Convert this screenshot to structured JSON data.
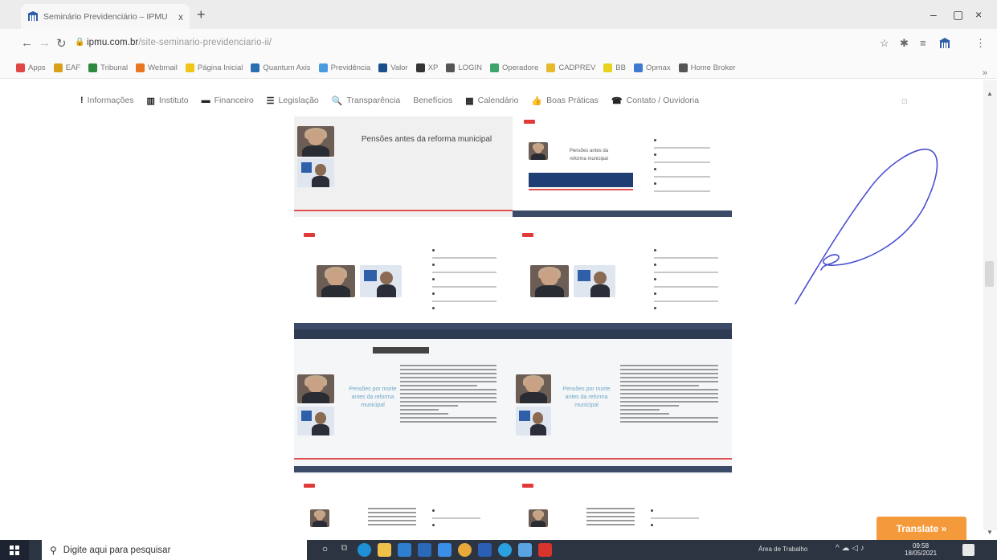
{
  "browser": {
    "tab_title": "Seminário Previdenciário – IPMU",
    "tab_close": "x",
    "new_tab": "+",
    "url_host": "ipmu.com.br",
    "url_path": "/site-seminario-previdenciario-ii/",
    "win_minimize": "–",
    "win_maximize": "▢",
    "win_close": "×"
  },
  "bookmarks": [
    {
      "label": "Apps",
      "color": "#e04848"
    },
    {
      "label": "EAF",
      "color": "#d9a019"
    },
    {
      "label": "Tribunal",
      "color": "#2d8a3e"
    },
    {
      "label": "Webmail",
      "color": "#e87722"
    },
    {
      "label": "Página Inicial",
      "color": "#f0c419"
    },
    {
      "label": "Quantum Axis",
      "color": "#2a6fb0"
    },
    {
      "label": "Previdência",
      "color": "#4a9be0"
    },
    {
      "label": "Valor",
      "color": "#1b4f8c"
    },
    {
      "label": "XP",
      "color": "#333333"
    },
    {
      "label": "LOGIN",
      "color": "#555555"
    },
    {
      "label": "Operadore",
      "color": "#3ca56b"
    },
    {
      "label": "CADPREV",
      "color": "#e8b82d"
    },
    {
      "label": "BB",
      "color": "#e8d21d"
    },
    {
      "label": "Opmax",
      "color": "#3f7ad0"
    },
    {
      "label": "Home Broker",
      "color": "#555555"
    }
  ],
  "bookmarks_more": "»",
  "site_nav": [
    {
      "icon": "!",
      "label": "Informações",
      "name": "nav-informacoes"
    },
    {
      "icon": "▥",
      "label": "Instituto",
      "name": "nav-instituto"
    },
    {
      "icon": "▬",
      "label": "Financeiro",
      "name": "nav-financeiro"
    },
    {
      "icon": "☰",
      "label": "Legislação",
      "name": "nav-legislacao"
    },
    {
      "icon": "🔍",
      "label": "Transparência",
      "name": "nav-transparencia"
    },
    {
      "icon": "",
      "label": "Benefícios",
      "name": "nav-beneficios"
    },
    {
      "icon": "▦",
      "label": "Calendário",
      "name": "nav-calendario"
    },
    {
      "icon": "👍",
      "label": "Boas Práticas",
      "name": "nav-boas-praticas"
    },
    {
      "icon": "☎",
      "label": "Contato / Ouvidoria",
      "name": "nav-contato"
    }
  ],
  "document": {
    "slide1_title": "Pensões antes da reforma municipal",
    "slide2_small_title": "Pensões antes da reforma municipal",
    "slide_teal_left": "Pensões por morte antes da reforma municipal",
    "slide_teal_right": "Pensões por morte antes da reforma municipal"
  },
  "translate_label": "Translate »",
  "taskbar": {
    "search_placeholder": "Digite aqui para pesquisar",
    "tray_label": "Área de Trabalho",
    "time": "09:58",
    "date": "18/05/2021"
  },
  "colors": {
    "signature_ink": "#4b4fd1",
    "translate_bg": "#f59a3a",
    "taskbar_bg": "#2c3441"
  }
}
